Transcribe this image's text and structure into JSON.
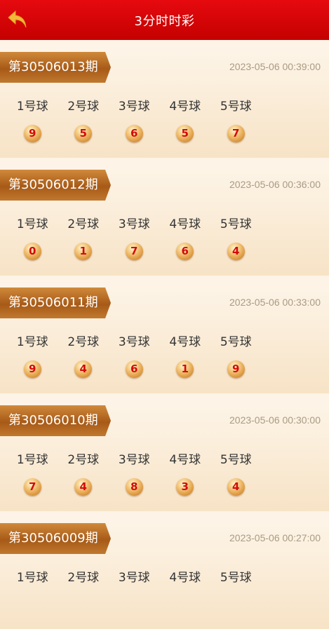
{
  "header": {
    "title": "3分时时彩"
  },
  "ball_labels": [
    "1号球",
    "2号球",
    "3号球",
    "4号球",
    "5号球"
  ],
  "draws": [
    {
      "issue": "第30506013期",
      "time": "2023-05-06 00:39:00",
      "numbers": [
        "9",
        "5",
        "6",
        "5",
        "7"
      ]
    },
    {
      "issue": "第30506012期",
      "time": "2023-05-06 00:36:00",
      "numbers": [
        "0",
        "1",
        "7",
        "6",
        "4"
      ]
    },
    {
      "issue": "第30506011期",
      "time": "2023-05-06 00:33:00",
      "numbers": [
        "9",
        "4",
        "6",
        "1",
        "9"
      ]
    },
    {
      "issue": "第30506010期",
      "time": "2023-05-06 00:30:00",
      "numbers": [
        "7",
        "4",
        "8",
        "3",
        "4"
      ]
    },
    {
      "issue": "第30506009期",
      "time": "2023-05-06 00:27:00",
      "numbers": []
    }
  ],
  "colors": {
    "header": "#d40000",
    "issue_tag": "#b3641f",
    "ball_digit": "#d40b0b"
  }
}
